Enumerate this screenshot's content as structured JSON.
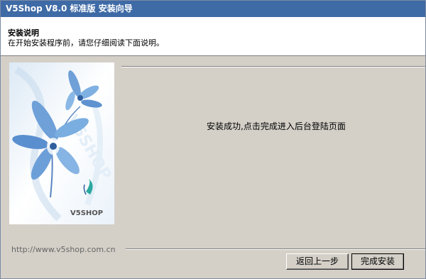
{
  "window": {
    "title": "V5Shop V8.0 标准版  安装向导"
  },
  "header": {
    "title": "安装说明",
    "subtitle": "在开始安装程序前，请您仔细阅读下面说明。"
  },
  "side_panel": {
    "logo_text": "V5SHOP",
    "watermark": "V5SHOP",
    "image": "blue-orchid-illustration"
  },
  "main": {
    "message": "安装成功,点击完成进入后台登陆页面"
  },
  "footer": {
    "url": "http://www.v5shop.com.cn",
    "back_label": "返回上一步",
    "finish_label": "完成安装"
  },
  "colors": {
    "titlebar": "#3e6aa6",
    "panel": "#d4d0c8",
    "flower": "#6fa0d8"
  }
}
